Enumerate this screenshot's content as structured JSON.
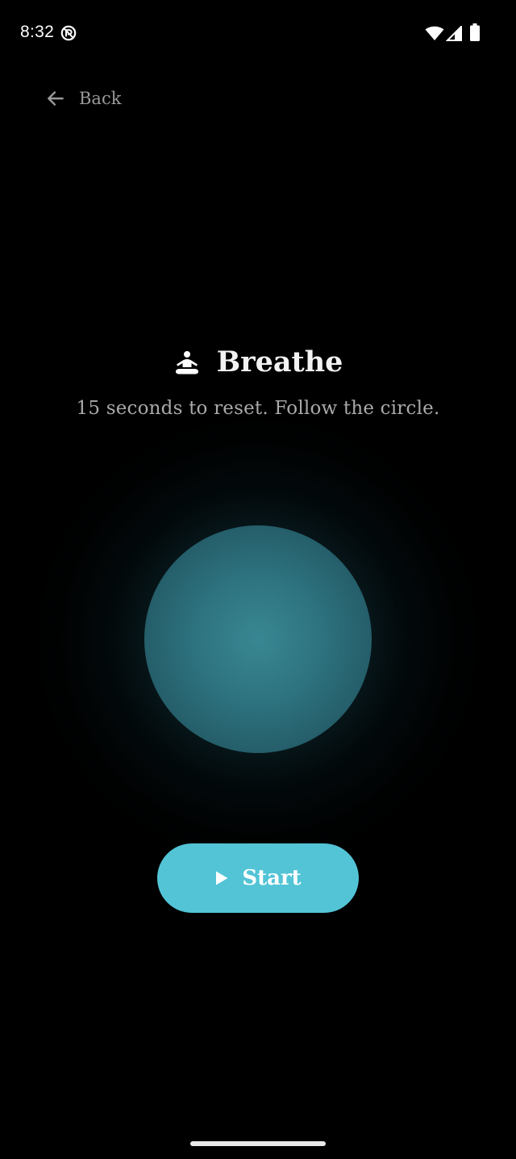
{
  "status_bar": {
    "time": "8:32",
    "icons": [
      "do-not-disturb-icon",
      "wifi-icon",
      "signal-icon",
      "battery-icon"
    ]
  },
  "nav": {
    "back_label": "Back",
    "back_icon": "arrow-left-icon"
  },
  "header": {
    "icon": "meditation-icon",
    "title": "Breathe",
    "subtitle": "15 seconds to reset. Follow the circle."
  },
  "breathing": {
    "circle_color": "#2f7683",
    "glow_color": "#3796a5"
  },
  "actions": {
    "start_label": "Start",
    "start_icon": "play-icon",
    "start_color": "#52c4d6"
  }
}
